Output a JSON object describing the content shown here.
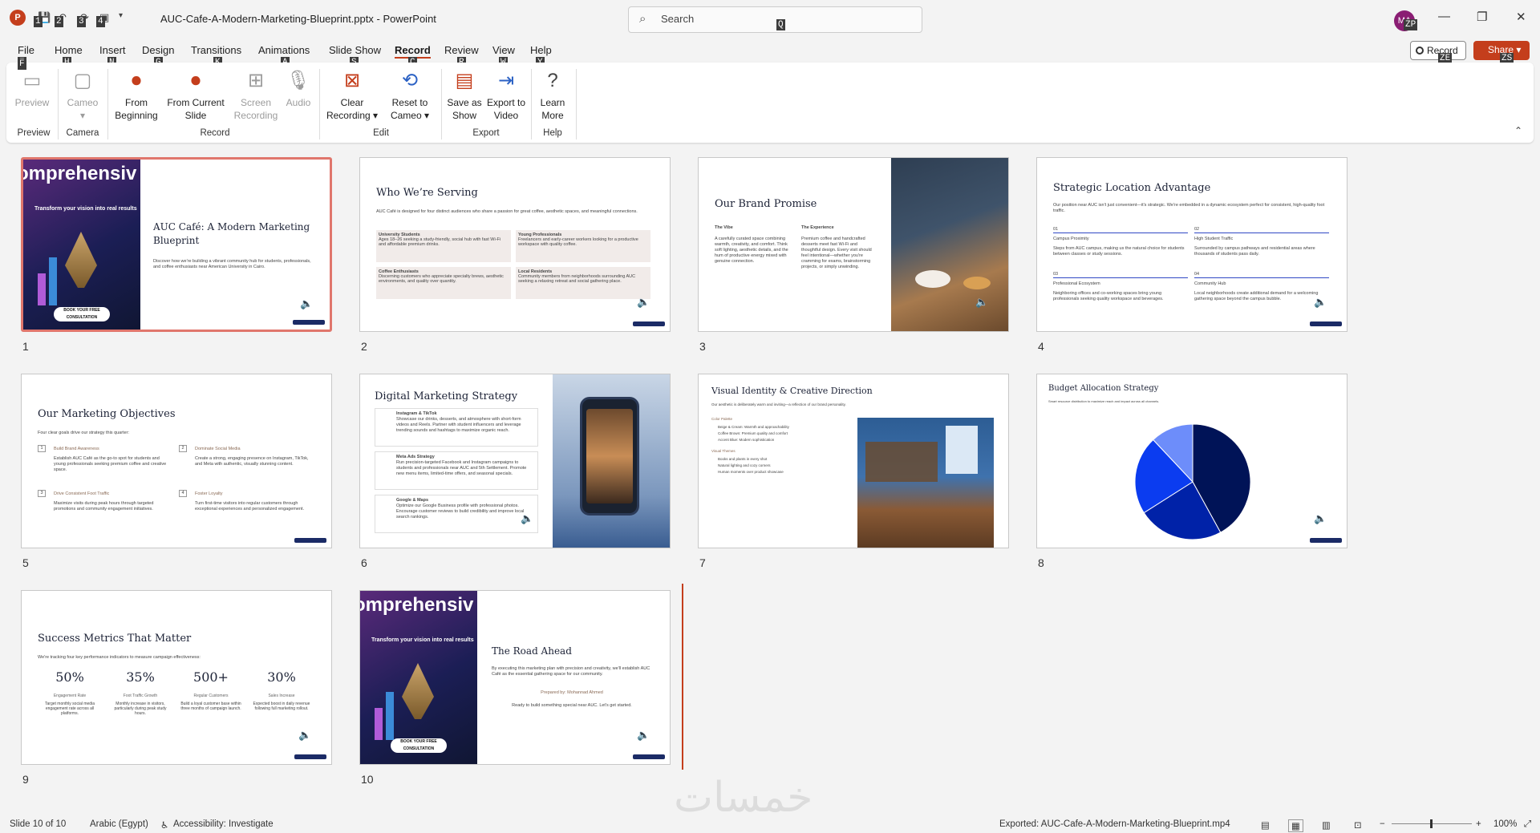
{
  "titlebar": {
    "qat_keytips": [
      "1",
      "2",
      "3",
      "4"
    ],
    "filename": "AUC-Cafe-A-Modern-Marketing-Blueprint.pptx",
    "app": "PowerPoint",
    "search_placeholder": "Search",
    "search_keytip": "Q",
    "avatar_initials": "MA",
    "avatar_keytip": "ZP",
    "accent": "#c43e1c"
  },
  "menu": {
    "tabs": [
      {
        "label": "File",
        "keytip": "F"
      },
      {
        "label": "Home",
        "keytip": "H"
      },
      {
        "label": "Insert",
        "keytip": "N"
      },
      {
        "label": "Design",
        "keytip": "G"
      },
      {
        "label": "Transitions",
        "keytip": "K"
      },
      {
        "label": "Animations",
        "keytip": "A"
      },
      {
        "label": "Slide Show",
        "keytip": "S"
      },
      {
        "label": "Record",
        "keytip": "C"
      },
      {
        "label": "Review",
        "keytip": "R"
      },
      {
        "label": "View",
        "keytip": "W"
      },
      {
        "label": "Help",
        "keytip": "Y"
      }
    ],
    "record_button": "Record",
    "record_keytip": "ZE",
    "share_button": "Share",
    "share_keytip": "ZS"
  },
  "ribbon": {
    "preview": "Preview",
    "cameo": "Cameo",
    "from_beginning": "From Beginning",
    "from_current": "From Current Slide",
    "screen_recording": "Screen Recording",
    "audio": "Audio",
    "clear_recording": "Clear Recording",
    "reset_to_cameo": "Reset to Cameo",
    "save_as_show": "Save as Show",
    "export_to_video": "Export to Video",
    "learn_more": "Learn More",
    "groups": {
      "preview": "Preview",
      "camera": "Camera",
      "record": "Record",
      "edit": "Edit",
      "export": "Export",
      "help": "Help"
    }
  },
  "slides": [
    {
      "number": "1",
      "title": "AUC Café: A Modern Marketing Blueprint",
      "body": "Discover how we're building a vibrant community hub for students, professionals, and coffee enthusiasts near American University in Cairo.",
      "cover_heading": "omprehensiv Marketing Pla",
      "cover_sub": "Transform your vision into real results",
      "cover_btn": "BOOK YOUR FREE CONSULTATION"
    },
    {
      "number": "2",
      "title": "Who We’re Serving",
      "intro": "AUC Café is designed for four distinct audiences who share a passion for great coffee, aesthetic spaces, and meaningful connections.",
      "cards": [
        {
          "h": "University Students",
          "t": "Ages 18–26 seeking a study-friendly, social hub with fast Wi-Fi and affordable premium drinks."
        },
        {
          "h": "Young Professionals",
          "t": "Freelancers and early-career workers looking for a productive workspace with quality coffee."
        },
        {
          "h": "Coffee Enthusiasts",
          "t": "Discerning customers who appreciate specialty brews, aesthetic environments, and quality over quantity."
        },
        {
          "h": "Local Residents",
          "t": "Community members from neighborhoods surrounding AUC seeking a relaxing retreat and social gathering place."
        }
      ]
    },
    {
      "number": "3",
      "title": "Our Brand Promise",
      "col1_h": "The Vibe",
      "col1_t": "A carefully curated space combining warmth, creativity, and comfort. Think soft lighting, aesthetic details, and the hum of productive energy mixed with genuine connection.",
      "col2_h": "The Experience",
      "col2_t": "Premium coffee and handcrafted desserts meet fast Wi-Fi and thoughtful design. Every visit should feel intentional—whether you're cramming for exams, brainstorming projects, or simply unwinding."
    },
    {
      "number": "4",
      "title": "Strategic Location Advantage",
      "intro": "Our position near AUC isn't just convenient—it's strategic. We're embedded in a dynamic ecosystem perfect for consistent, high-quality foot traffic.",
      "items": [
        {
          "n": "01",
          "h": "Campus Proximity",
          "t": "Steps from AUC campus, making us the natural choice for students between classes or study sessions."
        },
        {
          "n": "02",
          "h": "High Student Traffic",
          "t": "Surrounded by campus pathways and residential areas where thousands of students pass daily."
        },
        {
          "n": "03",
          "h": "Professional Ecosystem",
          "t": "Neighboring offices and co-working spaces bring young professionals seeking quality workspace and beverages."
        },
        {
          "n": "04",
          "h": "Community Hub",
          "t": "Local neighborhoods create additional demand for a welcoming gathering space beyond the campus bubble."
        }
      ]
    },
    {
      "number": "5",
      "title": "Our Marketing Objectives",
      "intro": "Four clear goals drive our strategy this quarter:",
      "items": [
        {
          "n": "1",
          "h": "Build Brand Awareness",
          "t": "Establish AUC Café as the go-to spot for students and young professionals seeking premium coffee and creative space."
        },
        {
          "n": "2",
          "h": "Dominate Social Media",
          "t": "Create a strong, engaging presence on Instagram, TikTok, and Meta with authentic, visually stunning content."
        },
        {
          "n": "3",
          "h": "Drive Consistent Foot Traffic",
          "t": "Maximize visits during peak hours through targeted promotions and community engagement initiatives."
        },
        {
          "n": "4",
          "h": "Foster Loyalty",
          "t": "Turn first-time visitors into regular customers through exceptional experiences and personalized engagement."
        }
      ]
    },
    {
      "number": "6",
      "title": "Digital Marketing Strategy",
      "items": [
        {
          "h": "Instagram & TikTok",
          "t": "Showcase our drinks, desserts, and atmosphere with short-form videos and Reels. Partner with student influencers and leverage trending sounds and hashtags to maximize organic reach."
        },
        {
          "h": "Meta Ads Strategy",
          "t": "Run precision-targeted Facebook and Instagram campaigns to students and professionals near AUC and 5th Settlement. Promote new menu items, limited-time offers, and seasonal specials."
        },
        {
          "h": "Google & Maps",
          "t": "Optimize our Google Business profile with professional photos. Encourage customer reviews to build credibility and improve local search rankings."
        }
      ]
    },
    {
      "number": "7",
      "title": "Visual Identity & Creative Direction",
      "intro": "Our aesthetic is deliberately warm and inviting—a reflection of our brand personality.",
      "palette_h": "Color Palette",
      "palette": [
        "Beige & Cream: Warmth and approachability",
        "Coffee Brown: Premium quality and comfort",
        "Accent Blue: Modern sophistication"
      ],
      "themes_h": "Visual Themes",
      "themes": [
        "Books and plants in every shot",
        "Natural lighting and cozy corners",
        "Human moments over product showcase"
      ]
    },
    {
      "number": "8",
      "title": "Budget Allocation Strategy",
      "intro": "Smart resource distribution to maximize reach and impact across all channels."
    },
    {
      "number": "9",
      "title": "Success Metrics That Matter",
      "intro": "We're tracking four key performance indicators to measure campaign effectiveness:",
      "metrics": [
        {
          "v": "50%",
          "l": "Engagement Rate",
          "t": "Target monthly social media engagement rate across all platforms."
        },
        {
          "v": "35%",
          "l": "Foot Traffic Growth",
          "t": "Monthly increase in visitors, particularly during peak study hours."
        },
        {
          "v": "500+",
          "l": "Regular Customers",
          "t": "Build a loyal customer base within three months of campaign launch."
        },
        {
          "v": "30%",
          "l": "Sales Increase",
          "t": "Expected boost in daily revenue following full marketing rollout."
        }
      ]
    },
    {
      "number": "10",
      "title": "The Road Ahead",
      "body": "By executing this marketing plan with precision and creativity, we'll establish AUC Café as the essential gathering space for our community.",
      "prepared": "Prepared by: Mohannad Ahmed",
      "closing": "Ready to build something special near AUC. Let's get started.",
      "cover_heading": "omprehensiv Marketing Pla",
      "cover_sub": "Transform your vision into real results",
      "cover_btn": "BOOK YOUR FREE CONSULTATION"
    }
  ],
  "chart_data": {
    "type": "pie",
    "title": "",
    "values": [
      42,
      24,
      22,
      12
    ],
    "colors": [
      "#001357",
      "#0022a8",
      "#0b3cf0",
      "#6d8dfa"
    ]
  },
  "status": {
    "slide": "Slide 10 of 10",
    "language": "Arabic (Egypt)",
    "accessibility": "Accessibility: Investigate",
    "exported": "Exported: AUC-Cafe-A-Modern-Marketing-Blueprint.mp4",
    "zoom": "100%"
  },
  "watermark": "خمسات"
}
